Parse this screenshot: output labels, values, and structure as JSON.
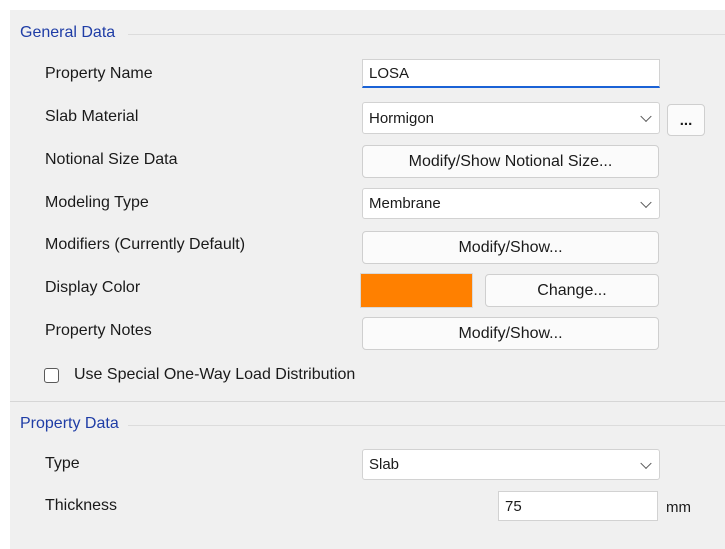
{
  "general": {
    "header": "General Data",
    "rows": {
      "property_name": {
        "label": "Property Name",
        "value": "LOSA"
      },
      "slab_material": {
        "label": "Slab Material",
        "value": "Hormigon",
        "more_label": "..."
      },
      "notional": {
        "label": "Notional Size Data",
        "button": "Modify/Show Notional Size..."
      },
      "modeling": {
        "label": "Modeling Type",
        "value": "Membrane"
      },
      "modifiers": {
        "label": "Modifiers (Currently Default)",
        "button": "Modify/Show..."
      },
      "display_color": {
        "label": "Display Color",
        "color": "#ff8000",
        "button": "Change..."
      },
      "notes": {
        "label": "Property Notes",
        "button": "Modify/Show..."
      }
    },
    "checkbox": {
      "label": "Use Special One-Way Load Distribution",
      "checked": false
    }
  },
  "property": {
    "header": "Property Data",
    "type": {
      "label": "Type",
      "value": "Slab"
    },
    "thickness": {
      "label": "Thickness",
      "value": "75",
      "unit": "mm"
    }
  },
  "colors": {
    "header": "#1f3da6",
    "focus": "#1a62d6",
    "panel": "#f0f0f0"
  }
}
